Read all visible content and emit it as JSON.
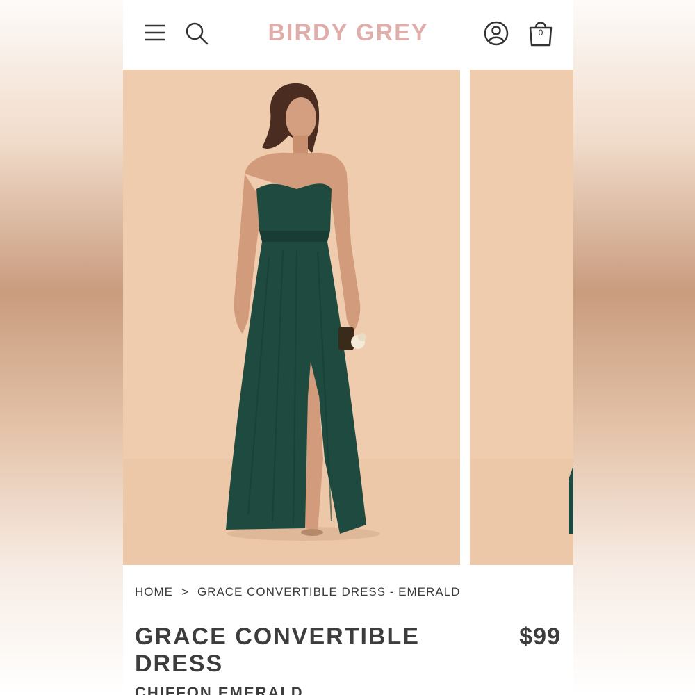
{
  "header": {
    "brand": "BIRDY GREY",
    "cart_count": "0",
    "icons": [
      "menu-icon",
      "search-icon",
      "account-icon",
      "cart-icon"
    ],
    "brand_color": "#dfaeaa"
  },
  "gallery": {
    "backdrop_color": "#f0ccae",
    "dress_color": "#1f4a40"
  },
  "breadcrumb": {
    "home": "HOME",
    "separator": ">",
    "current": "GRACE CONVERTIBLE DRESS - EMERALD"
  },
  "product": {
    "title": "GRACE CONVERTIBLE DRESS",
    "price": "$99",
    "subtitle": "CHIFFON EMERALD"
  }
}
